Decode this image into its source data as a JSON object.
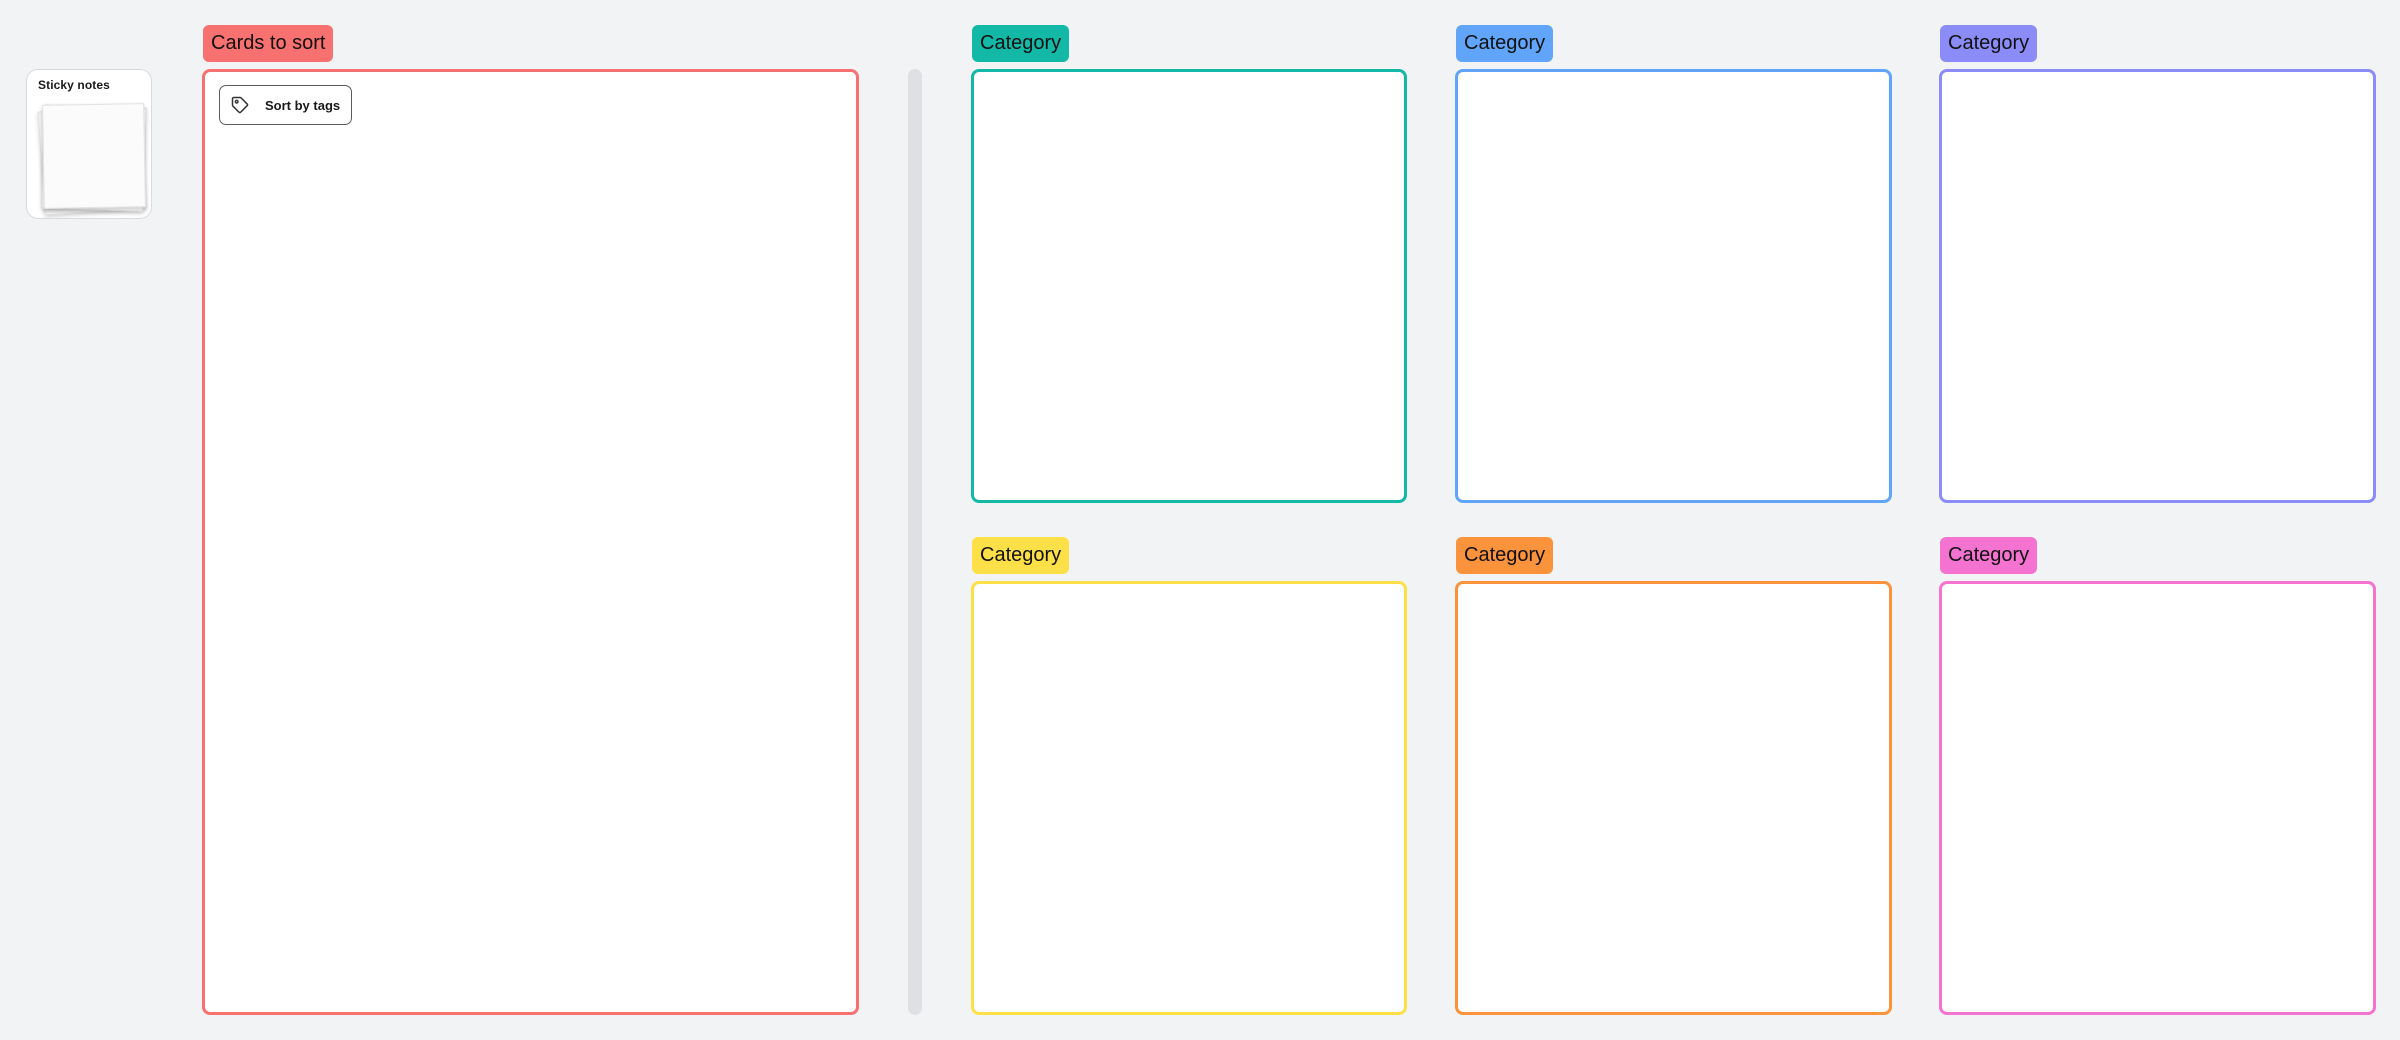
{
  "sticky_notes": {
    "title": "Sticky notes"
  },
  "sort_section": {
    "label": "Cards to sort",
    "color": "#f87171",
    "sort_button_label": "Sort by tags"
  },
  "categories": [
    {
      "label": "Category",
      "color": "#14b8a6"
    },
    {
      "label": "Category",
      "color": "#60a5fa"
    },
    {
      "label": "Category",
      "color": "#8b8cf7"
    },
    {
      "label": "Category",
      "color": "#fde047"
    },
    {
      "label": "Category",
      "color": "#fb923c"
    },
    {
      "label": "Category",
      "color": "#f472d0"
    }
  ]
}
